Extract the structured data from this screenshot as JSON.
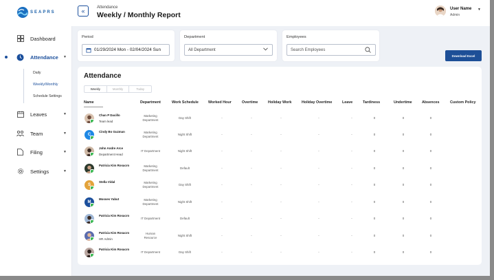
{
  "brand": {
    "logo_text": "SEAPRS"
  },
  "sidebar": {
    "items": [
      {
        "label": "Dashboard",
        "icon": "dashboard-icon"
      },
      {
        "label": "Attendance",
        "icon": "clock-icon",
        "active": true
      },
      {
        "label": "Leaves",
        "icon": "calendar-icon"
      },
      {
        "label": "Team",
        "icon": "team-icon"
      },
      {
        "label": "Filing",
        "icon": "file-icon"
      },
      {
        "label": "Settings",
        "icon": "gear-icon"
      }
    ],
    "attendance_sub": [
      "Daily",
      "Weekly/Monthly",
      "Schedule Settings"
    ]
  },
  "header": {
    "breadcrumb": "Attendance",
    "title": "Weekly / Monthly Report",
    "user_name": "User Name",
    "user_role": "Admin"
  },
  "filters": {
    "period_label": "Period",
    "period_value": "01/29/2024 Mon - 02/04/2024 Sun",
    "department_label": "Department",
    "department_value": "All Department",
    "employees_label": "Employees",
    "employees_placeholder": "Search Employees",
    "download_label": "Download Excel"
  },
  "table": {
    "title": "Attendance",
    "tabs": [
      "Weekly",
      "Monthly",
      "Today"
    ],
    "active_tab": "Weekly",
    "columns": [
      "Name",
      "Department",
      "Work Schedule",
      "Worked Hour",
      "Overtime",
      "Holiday Work",
      "Holiday Overtime",
      "Leave",
      "Tardiness",
      "Undertime",
      "Absences",
      "Custom Policy"
    ],
    "rows": [
      {
        "name": "Chan P Dacillo",
        "role": "Team lead",
        "avatar": "photo",
        "dept": [
          "Marketing",
          "Department"
        ],
        "schedule": "Day Shift",
        "tardiness": "0",
        "undertime": "0",
        "absences": "0"
      },
      {
        "name": "Cindy Bo Guzman",
        "role": "",
        "avatar": "C",
        "avatar_color": "#1e88e5",
        "dept": [
          "Marketing",
          "Department"
        ],
        "schedule": "Night Shift",
        "tardiness": "0",
        "undertime": "0",
        "absences": "0"
      },
      {
        "name": "John Andre Arce",
        "role": "Department Head",
        "avatar": "photo",
        "dept": [
          "IT Department"
        ],
        "schedule": "Night Shift",
        "tardiness": "0",
        "undertime": "0",
        "absences": "0"
      },
      {
        "name": "Patricia Kim Rosacro",
        "role": "",
        "avatar": "photo",
        "dept": [
          "Marketing",
          "Department"
        ],
        "schedule": "Default",
        "tardiness": "0",
        "undertime": "0",
        "absences": "0"
      },
      {
        "name": "Stella Vidal",
        "role": "",
        "avatar": "S",
        "avatar_color": "#e3a33b",
        "dept": [
          "Marketing",
          "Department"
        ],
        "schedule": "Day Shift",
        "tardiness": "0",
        "undertime": "0",
        "absences": "0"
      },
      {
        "name": "Mosses Yabut",
        "role": "",
        "avatar": "M",
        "avatar_color": "#1b4f9c",
        "dept": [
          "Marketing",
          "Department"
        ],
        "schedule": "Night Shift",
        "tardiness": "0",
        "undertime": "0",
        "absences": "0"
      },
      {
        "name": "Patricia Kim Rosacro",
        "role": "",
        "avatar": "photo",
        "dept": [
          "IT Department"
        ],
        "schedule": "Default",
        "tardiness": "0",
        "undertime": "0",
        "absences": "0"
      },
      {
        "name": "Patricia Kim Rosacro",
        "role": "HR Admin",
        "avatar": "photo",
        "dept": [
          "Human",
          "Resource"
        ],
        "schedule": "Night Shift",
        "tardiness": "0",
        "undertime": "0",
        "absences": "0"
      },
      {
        "name": "Patricia Kim Rosacro",
        "role": "",
        "avatar": "photo",
        "dept": [
          "IT Department"
        ],
        "schedule": "Day Shift",
        "tardiness": "0",
        "undertime": "0",
        "absences": "0"
      }
    ],
    "empty_marker": "-"
  },
  "colors": {
    "accent": "#1b4f9c",
    "status_online": "#3cba54"
  }
}
